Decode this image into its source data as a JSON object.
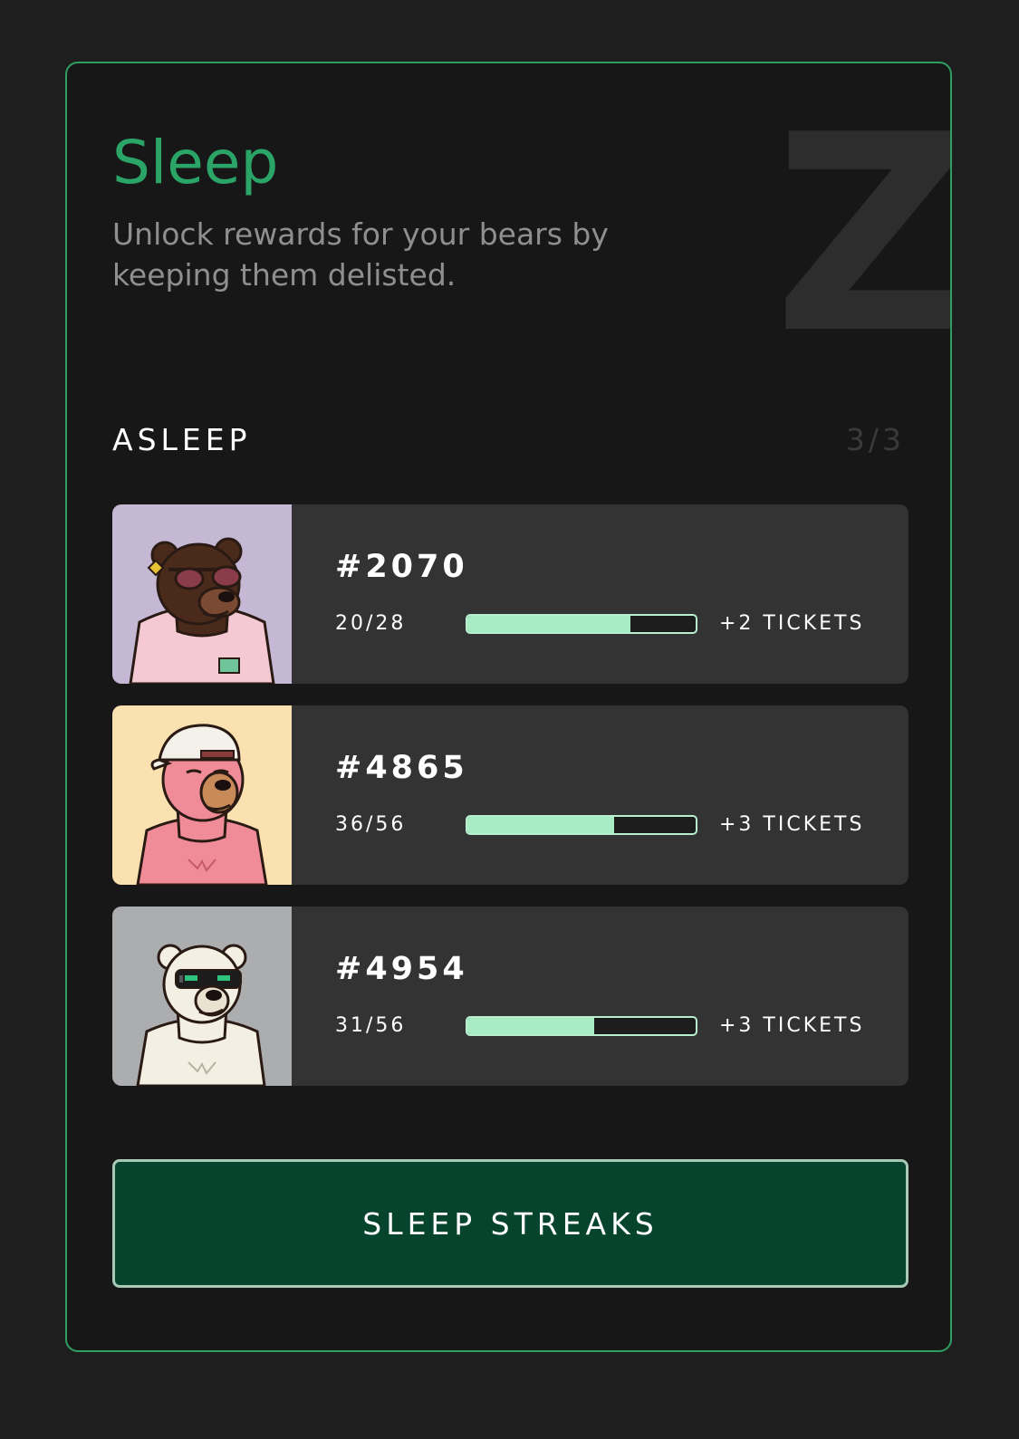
{
  "panel": {
    "title": "Sleep",
    "subtitle": "Unlock rewards for your bears by keeping them delisted.",
    "decor_letter": "Z"
  },
  "section": {
    "label": "ASLEEP",
    "count": "3/3"
  },
  "bears": [
    {
      "id": "#2070",
      "progress_text": "20/28",
      "progress": 0.714,
      "tickets": "+2 TICKETS",
      "avatar_bg": "#c5b8d4",
      "fur": "#4a2a1a",
      "accessory": "sunglasses-hoodie"
    },
    {
      "id": "#4865",
      "progress_text": "36/56",
      "progress": 0.643,
      "tickets": "+3 TICKETS",
      "avatar_bg": "#fbe1b0",
      "fur": "#f08c97",
      "accessory": "cap"
    },
    {
      "id": "#4954",
      "progress_text": "31/56",
      "progress": 0.554,
      "tickets": "+3 TICKETS",
      "avatar_bg": "#acadaf",
      "fur": "#f3efe2",
      "accessory": "visor"
    }
  ],
  "button": {
    "label": "SLEEP STREAKS"
  },
  "colors": {
    "accent": "#2ba467",
    "bar_fill": "#a8ecc5",
    "button_bg": "#06442d"
  }
}
